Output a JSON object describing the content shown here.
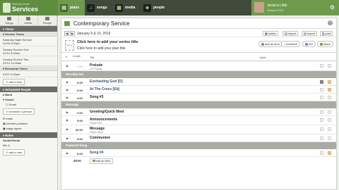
{
  "brand": {
    "small": "Planning Center",
    "name": "Services"
  },
  "nav": [
    {
      "label": "plans",
      "icon": "plans-icon",
      "glyph": "▤"
    },
    {
      "label": "songs",
      "icon": "music-note-icon",
      "glyph": "♫"
    },
    {
      "label": "media",
      "icon": "film-icon",
      "glyph": "▦"
    },
    {
      "label": "people",
      "icon": "people-icon",
      "glyph": "☻"
    }
  ],
  "user": {
    "name": "Jessica Little",
    "org": "Sample POD"
  },
  "sidebar": {
    "tabs": [
      "Songs",
      "Media",
      "People"
    ],
    "times_header": "Times",
    "service_times_label": "▾ Service Times",
    "service_times": [
      {
        "name": "Saturday Night Service",
        "time": "01/09 5:00pm"
      },
      {
        "name": "Sunday Service One",
        "time": "01/10 9:00am"
      },
      {
        "name": "Sunday Service Two",
        "time": "01/10 11:00am"
      }
    ],
    "rehearsal_label": "▾ Rehearsal Times",
    "rehearsal_time": "01/07 6:00pm",
    "add_time": "add a time",
    "scheduled_header": "Scheduled People",
    "band_label": "▸ Band",
    "vocals_label": "▾ Vocals",
    "vocals_opt": "Email",
    "schedule_btn": "schedule a person",
    "links": [
      "email",
      "needed positions",
      "stage layout"
    ],
    "notes_header": "Notes",
    "av_label": "Audio/Visual",
    "mic_label": "Mic A",
    "add_note": "add a note"
  },
  "plan": {
    "title": "Contemporary Service",
    "dates": "January 9 & 10, 2016",
    "tools": [
      "matrix",
      "import",
      "export",
      "print"
    ],
    "series_art": "add art",
    "series_title": "Click here to add your series title",
    "plan_title_prompt": "Click here to add your plan title",
    "actions": [
      "add an item",
      "rehearse",
      "live",
      "share"
    ],
    "col_length": "Length",
    "col_title": "Title",
    "col_lights": "Lights",
    "total": "49:00",
    "add_item": "add an item"
  },
  "items": [
    {
      "kind": "item",
      "len": "2:00",
      "light": true,
      "title": "Prelude",
      "sub": "CD Playing"
    },
    {
      "kind": "header",
      "title": "Worship Set"
    },
    {
      "kind": "song",
      "len": "6:00",
      "title": "Everlasting God [D]",
      "dark": true
    },
    {
      "kind": "song",
      "len": "6:00",
      "title": "At The Cross [Eb]"
    },
    {
      "kind": "item",
      "len": "4:00",
      "title": "Song #3"
    },
    {
      "kind": "header",
      "title": "Message"
    },
    {
      "kind": "item",
      "len": "2:00",
      "title": "Greeting/Quick Meet"
    },
    {
      "kind": "item",
      "len": "5:00",
      "title": "Announcements",
      "sub": "Pastor Phil"
    },
    {
      "kind": "item",
      "len": "30:00",
      "title": "Message",
      "sub": "Pastor John"
    },
    {
      "kind": "item",
      "len": "5:00",
      "title": "Communion"
    },
    {
      "kind": "header",
      "title": "Featured Song"
    },
    {
      "kind": "song",
      "len": "5:00",
      "title": "Song #4"
    }
  ]
}
